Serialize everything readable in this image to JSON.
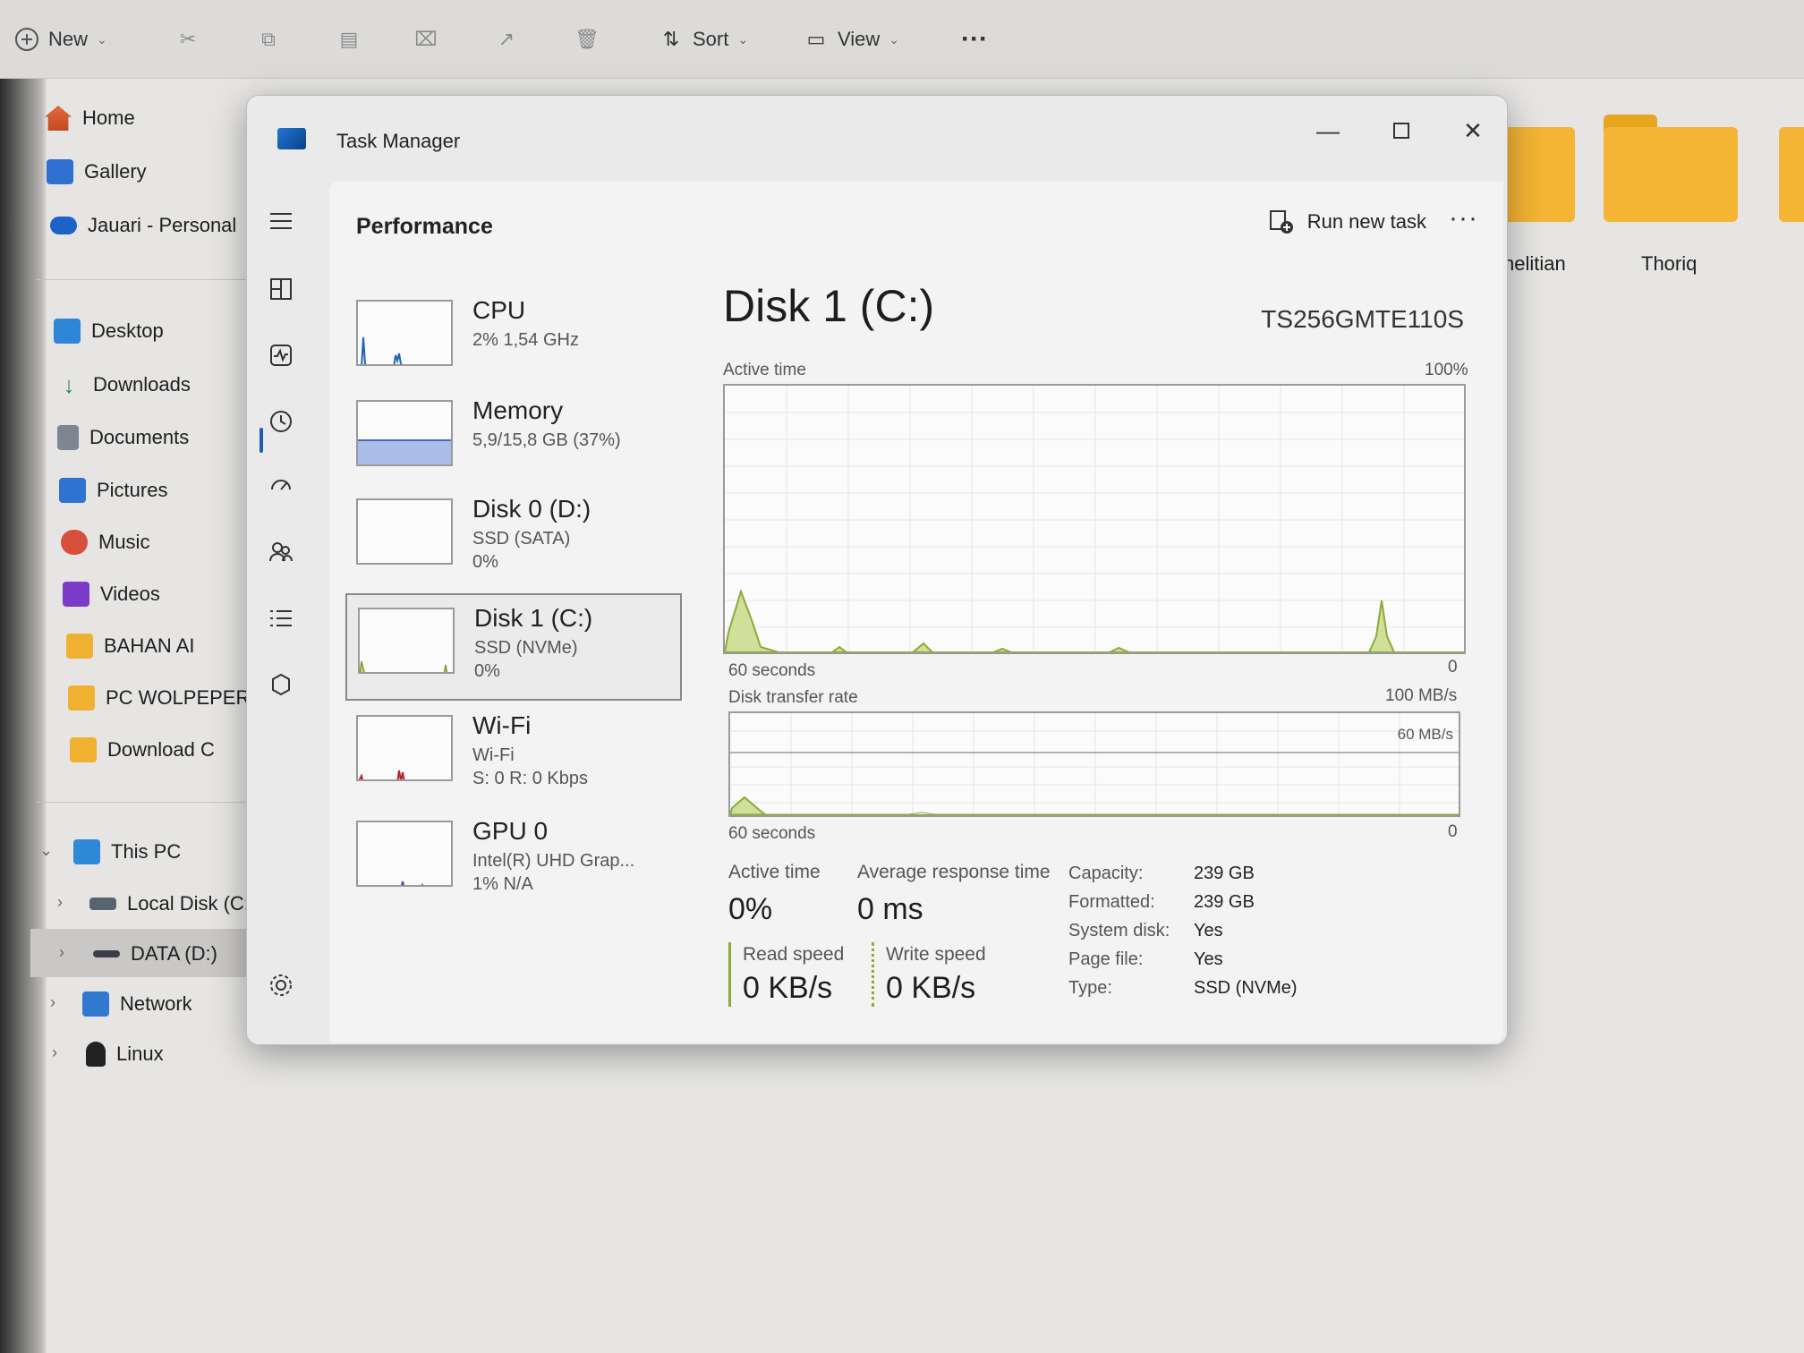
{
  "explorer": {
    "toolbar": {
      "new_label": "New",
      "sort_label": "Sort",
      "view_label": "View",
      "more_label": "···"
    },
    "nav": {
      "home": "Home",
      "gallery": "Gallery",
      "onedrive": "Jauari - Personal",
      "desktop": "Desktop",
      "downloads": "Downloads",
      "documents": "Documents",
      "pictures": "Pictures",
      "music": "Music",
      "videos": "Videos",
      "bahan_ai": "BAHAN AI",
      "pc_wolpeper": "PC WOLPEPER",
      "download_c": "Download C",
      "this_pc": "This PC",
      "local_disk": "Local Disk (C:)",
      "data_d": "DATA (D:)",
      "network": "Network",
      "linux": "Linux"
    },
    "folders": {
      "folder1_label": "nelitian",
      "folder2_label": "Thoriq"
    }
  },
  "task_manager": {
    "title": "Task Manager",
    "page_title": "Performance",
    "run_new_task": "Run new task",
    "more": "···",
    "perf_list": {
      "cpu": {
        "name": "CPU",
        "line1": "2% 1,54 GHz"
      },
      "memory": {
        "name": "Memory",
        "line1": "5,9/15,8 GB (37%)"
      },
      "disk0": {
        "name": "Disk 0 (D:)",
        "line1": "SSD (SATA)",
        "line2": "0%"
      },
      "disk1": {
        "name": "Disk 1 (C:)",
        "line1": "SSD (NVMe)",
        "line2": "0%"
      },
      "wifi": {
        "name": "Wi-Fi",
        "line1": "Wi-Fi",
        "line2": "S: 0 R: 0 Kbps"
      },
      "gpu0": {
        "name": "GPU 0",
        "line1": "Intel(R) UHD Grap...",
        "line2": "1% N/A"
      }
    },
    "detail": {
      "title": "Disk 1 (C:)",
      "model": "TS256GMTE110S",
      "active_time_label": "Active time",
      "active_time_max": "100%",
      "graph1_xlabel": "60 seconds",
      "graph1_zero": "0",
      "transfer_label": "Disk transfer rate",
      "transfer_max": "100 MB/s",
      "transfer_mid": "60 MB/s",
      "graph2_xlabel": "60 seconds",
      "graph2_zero": "0",
      "stats": {
        "active_time_label": "Active time",
        "active_time_value": "0%",
        "avg_resp_label": "Average response time",
        "avg_resp_value": "0 ms",
        "read_label": "Read speed",
        "read_value": "0 KB/s",
        "write_label": "Write speed",
        "write_value": "0 KB/s"
      },
      "props": {
        "capacity_k": "Capacity:",
        "capacity_v": "239 GB",
        "formatted_k": "Formatted:",
        "formatted_v": "239 GB",
        "system_k": "System disk:",
        "system_v": "Yes",
        "pagefile_k": "Page file:",
        "pagefile_v": "Yes",
        "type_k": "Type:",
        "type_v": "SSD (NVMe)"
      }
    },
    "colors": {
      "disk_graph": "#9bbb3c",
      "cpu_graph": "#1f63b8",
      "memory_fill": "#9db5e4",
      "wifi_graph": "#b0262d",
      "gpu_graph": "#6a46b8"
    }
  }
}
